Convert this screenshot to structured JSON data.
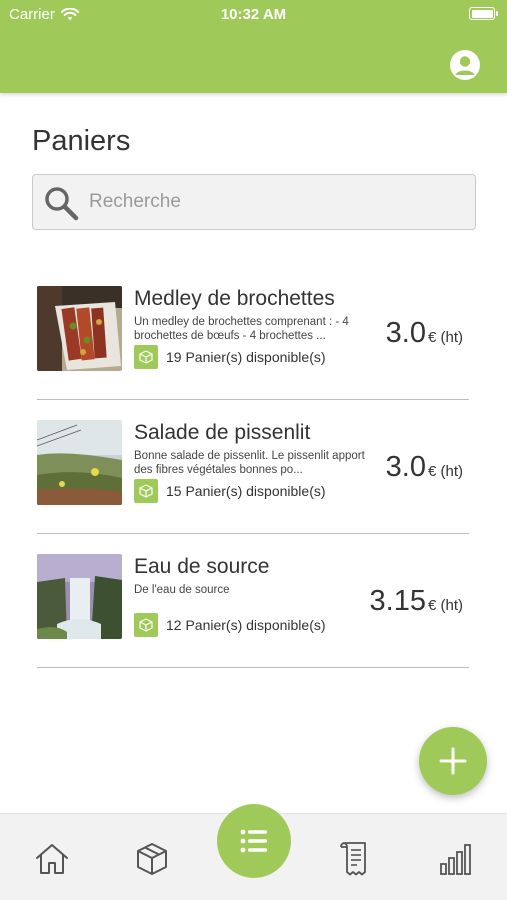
{
  "status_bar": {
    "carrier": "Carrier",
    "time": "10:32 AM",
    "icons": [
      "wifi-icon",
      "battery-icon"
    ]
  },
  "header": {
    "profile_icon": "user-icon",
    "accent_color": "#9fca5a"
  },
  "page": {
    "title": "Paniers"
  },
  "search": {
    "placeholder": "Recherche",
    "value": "",
    "icon": "search-icon"
  },
  "items": [
    {
      "name": "Medley de brochettes",
      "description": "Un medley de brochettes comprenant : - 4 brochettes de bœufs - 4 brochettes ...",
      "stock": "19 Panier(s) disponible(s)",
      "price": "3.0",
      "unit": "€ (ht)"
    },
    {
      "name": "Salade de pissenlit",
      "description": "Bonne salade de pissenlit. Le pissenlit apport des fibres végétales bonnes po...",
      "stock": "15 Panier(s) disponible(s)",
      "price": "3.0",
      "unit": "€ (ht)"
    },
    {
      "name": "Eau de source",
      "description": "De l'eau de source",
      "stock": "12 Panier(s) disponible(s)",
      "price": "3.15",
      "unit": "€ (ht)"
    }
  ],
  "fab": {
    "icon": "plus-icon"
  },
  "tabbar": {
    "tabs": [
      "home-icon",
      "box-icon",
      "list-icon",
      "receipt-icon",
      "bar-chart-icon"
    ],
    "active": "list-icon"
  }
}
